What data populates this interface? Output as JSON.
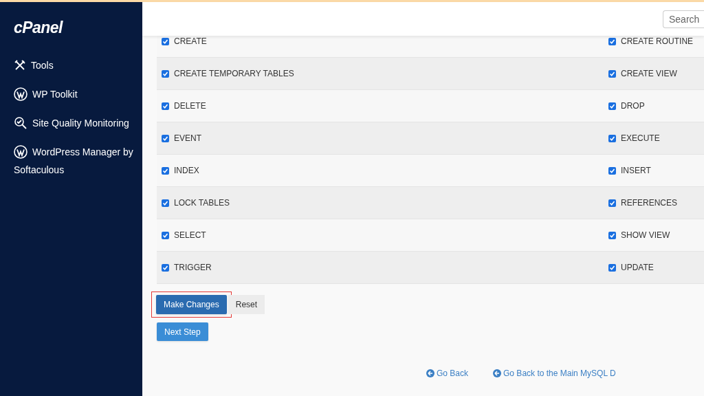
{
  "sidebar": {
    "logo": "cPanel",
    "items": [
      {
        "kind": "tools",
        "label": "Tools"
      },
      {
        "kind": "wordpress",
        "label": "WP Toolkit"
      },
      {
        "kind": "quality",
        "label": "Site Quality Monitoring"
      },
      {
        "kind": "wordpress",
        "label": "WordPress Manager by Softaculous"
      }
    ]
  },
  "header": {
    "search": {
      "placeholder": "Search"
    }
  },
  "privileges": [
    [
      {
        "label": "CREATE",
        "checked": true
      },
      {
        "label": "CREATE ROUTINE",
        "checked": true
      }
    ],
    [
      {
        "label": "CREATE TEMPORARY TABLES",
        "checked": true
      },
      {
        "label": "CREATE VIEW",
        "checked": true
      }
    ],
    [
      {
        "label": "DELETE",
        "checked": true
      },
      {
        "label": "DROP",
        "checked": true
      }
    ],
    [
      {
        "label": "EVENT",
        "checked": true
      },
      {
        "label": "EXECUTE",
        "checked": true
      }
    ],
    [
      {
        "label": "INDEX",
        "checked": true
      },
      {
        "label": "INSERT",
        "checked": true
      }
    ],
    [
      {
        "label": "LOCK TABLES",
        "checked": true
      },
      {
        "label": "REFERENCES",
        "checked": true
      }
    ],
    [
      {
        "label": "SELECT",
        "checked": true
      },
      {
        "label": "SHOW VIEW",
        "checked": true
      }
    ],
    [
      {
        "label": "TRIGGER",
        "checked": true
      },
      {
        "label": "UPDATE",
        "checked": true
      }
    ]
  ],
  "actions": [
    {
      "label": "Make Changes",
      "highlighted": true
    },
    {
      "label": "Reset",
      "highlighted": false
    }
  ],
  "next_step": "Next Step",
  "links": [
    "Go Back",
    "Go Back to the Main MySQL D"
  ]
}
